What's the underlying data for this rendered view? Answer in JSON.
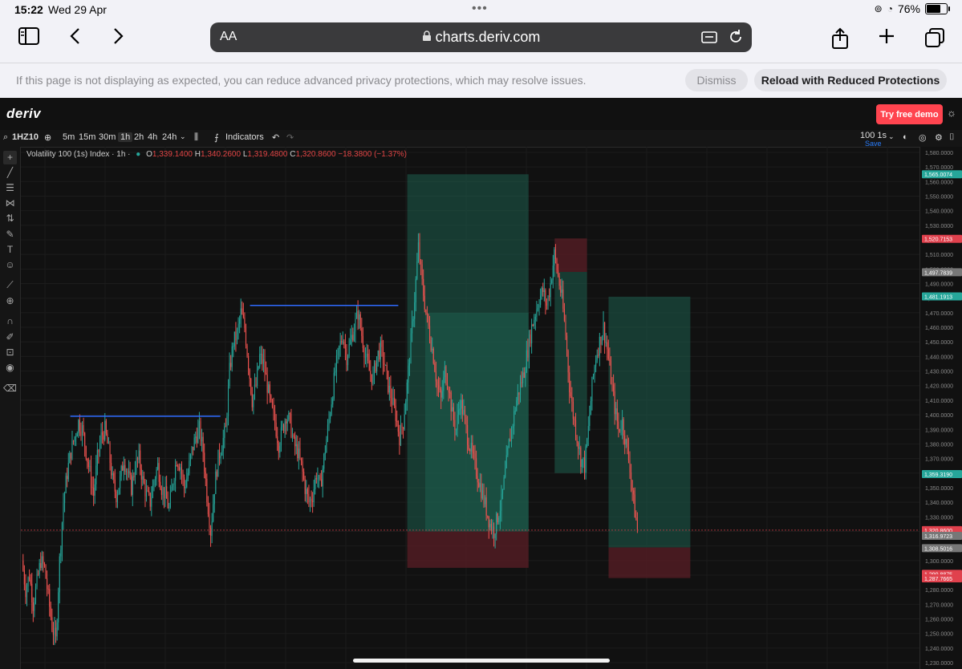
{
  "status_bar": {
    "time": "15:22",
    "date": "Wed 29 Apr",
    "battery": "76%",
    "battery_level": 0.76
  },
  "browser": {
    "text_size_label": "AA",
    "url": "charts.deriv.com",
    "icons": [
      "sidebar-icon",
      "back-icon",
      "forward-icon",
      "lock-icon",
      "extension-icon",
      "reload-icon",
      "share-icon",
      "new-tab-icon",
      "tabs-icon"
    ]
  },
  "privacy_banner": {
    "message": "If this page is not displaying as expected, you can reduce advanced privacy protections, which may resolve issues.",
    "dismiss_label": "Dismiss",
    "reload_label": "Reload with Reduced Protections"
  },
  "deriv": {
    "logo": "deriv",
    "try_demo_label": "Try free demo"
  },
  "chart_toolbar": {
    "symbol": "1HZ10",
    "timeframes": [
      "5m",
      "15m",
      "30m",
      "1h",
      "2h",
      "4h",
      "24h"
    ],
    "active_timeframe": "1h",
    "indicators_label": "Indicators",
    "tick_label": "100 1s",
    "save_label": "Save"
  },
  "legend": {
    "name": "Volatility 100 (1s) Index · 1h ·",
    "o_label": "O",
    "o": "1,339.1400",
    "h_label": "H",
    "h": "1,340.2600",
    "l_label": "L",
    "l": "1,319.4800",
    "c_label": "C",
    "c": "1,320.8600",
    "change": "−18.3800 (−1.37%)"
  },
  "colors": {
    "up": "#26a69a",
    "down": "#ef5350",
    "profit_zone": "#1d5e4e",
    "loss_zone": "#5a1e25",
    "trendline": "#2f6bff",
    "last_price": "#e0414d"
  },
  "chart_data": {
    "type": "candlestick",
    "series": [
      {
        "name": "Volatility 100 (1s) Index"
      }
    ],
    "ylim": [
      1230,
      1580
    ],
    "y_ticks": [
      "1,580.0000",
      "1,570.0000",
      "1,560.0000",
      "1,550.0000",
      "1,540.0000",
      "1,530.0000",
      "1,520.0000",
      "1,510.0000",
      "1,500.0000",
      "1,490.0000",
      "1,480.0000",
      "1,470.0000",
      "1,460.0000",
      "1,450.0000",
      "1,440.0000",
      "1,430.0000",
      "1,420.0000",
      "1,410.0000",
      "1,400.0000",
      "1,390.0000",
      "1,380.0000",
      "1,370.0000",
      "1,360.0000",
      "1,350.0000",
      "1,340.0000",
      "1,330.0000",
      "1,320.0000",
      "1,310.0000",
      "1,300.0000",
      "1,290.0000",
      "1,280.0000",
      "1,270.0000",
      "1,260.0000",
      "1,250.0000",
      "1,240.0000",
      "1,230.0000"
    ],
    "price_labels": [
      {
        "text": "1,565.0074",
        "value": 1565.0074,
        "color": "#26a69a"
      },
      {
        "text": "1,520.7153",
        "value": 1520.7153,
        "color": "#e0414d"
      },
      {
        "text": "1,497.7839",
        "value": 1497.7839,
        "color": "#777777"
      },
      {
        "text": "1,481.1913",
        "value": 1481.1913,
        "color": "#26a69a"
      },
      {
        "text": "1,359.3190",
        "value": 1359.319,
        "color": "#26a69a"
      },
      {
        "text": "1,320.8600",
        "value": 1320.86,
        "color": "#e0414d"
      },
      {
        "text": "1,316.9723",
        "value": 1316.9723,
        "color": "#777777"
      },
      {
        "text": "1,308.5016",
        "value": 1308.5016,
        "color": "#777777"
      },
      {
        "text": "1,290.8875",
        "value": 1290.8875,
        "color": "#e0414d"
      },
      {
        "text": "1,287.7665",
        "value": 1287.7665,
        "color": "#e0414d"
      }
    ],
    "last_price": 1320.86,
    "path": [
      1300,
      1280,
      1290,
      1270,
      1285,
      1300,
      1295,
      1275,
      1255,
      1245,
      1300,
      1340,
      1360,
      1375,
      1385,
      1395,
      1390,
      1375,
      1360,
      1345,
      1370,
      1385,
      1390,
      1375,
      1355,
      1345,
      1355,
      1370,
      1360,
      1350,
      1365,
      1370,
      1355,
      1345,
      1340,
      1355,
      1365,
      1350,
      1345,
      1335,
      1355,
      1370,
      1365,
      1350,
      1360,
      1375,
      1385,
      1390,
      1375,
      1345,
      1320,
      1350,
      1370,
      1380,
      1390,
      1430,
      1450,
      1455,
      1470,
      1460,
      1435,
      1410,
      1420,
      1440,
      1435,
      1420,
      1405,
      1395,
      1380,
      1390,
      1400,
      1395,
      1380,
      1375,
      1365,
      1350,
      1340,
      1345,
      1360,
      1350,
      1370,
      1390,
      1410,
      1430,
      1445,
      1455,
      1440,
      1450,
      1460,
      1470,
      1455,
      1440,
      1430,
      1425,
      1440,
      1445,
      1435,
      1420,
      1410,
      1400,
      1385,
      1395,
      1420,
      1450,
      1480,
      1515,
      1490,
      1470,
      1455,
      1440,
      1420,
      1410,
      1430,
      1420,
      1400,
      1390,
      1410,
      1400,
      1385,
      1375,
      1365,
      1355,
      1345,
      1335,
      1325,
      1320,
      1330,
      1340,
      1360,
      1380,
      1395,
      1410,
      1420,
      1430,
      1445,
      1460,
      1470,
      1480,
      1485,
      1475,
      1490,
      1510,
      1495,
      1480,
      1455,
      1420,
      1400,
      1385,
      1370,
      1365,
      1390,
      1420,
      1440,
      1450,
      1460,
      1445,
      1425,
      1405,
      1390,
      1395,
      1380,
      1365,
      1340,
      1321
    ],
    "boxes": [
      {
        "kind": "profit",
        "x0": 0.43,
        "x1": 0.565,
        "y0": 1320,
        "y1": 1565
      },
      {
        "kind": "loss",
        "x0": 0.43,
        "x1": 0.565,
        "y0": 1295,
        "y1": 1320
      },
      {
        "kind": "profit",
        "x0": 0.45,
        "x1": 0.565,
        "y0": 1320,
        "y1": 1470
      },
      {
        "kind": "profit",
        "x0": 0.594,
        "x1": 0.63,
        "y0": 1360,
        "y1": 1498
      },
      {
        "kind": "loss",
        "x0": 0.594,
        "x1": 0.63,
        "y0": 1498,
        "y1": 1521
      },
      {
        "kind": "profit",
        "x0": 0.654,
        "x1": 0.745,
        "y0": 1309,
        "y1": 1481
      },
      {
        "kind": "loss",
        "x0": 0.654,
        "x1": 0.745,
        "y0": 1288,
        "y1": 1309
      }
    ],
    "trendlines": [
      {
        "x0": 0.055,
        "x1": 0.222,
        "y": 1399
      },
      {
        "x0": 0.255,
        "x1": 0.42,
        "y": 1475
      }
    ]
  }
}
